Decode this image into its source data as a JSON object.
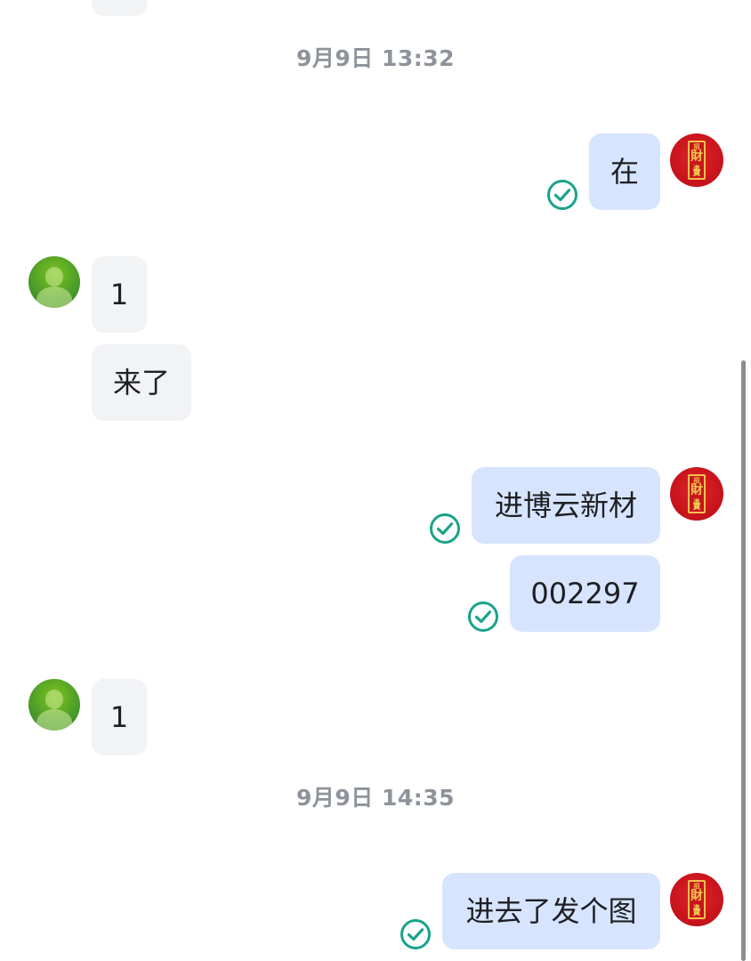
{
  "messages": [
    {
      "id": "top",
      "direction": "in",
      "text": ""
    },
    {
      "id": "ts1",
      "type": "timestamp",
      "text": "9月9日 13:32"
    },
    {
      "id": "m1",
      "direction": "out",
      "text": "在",
      "status": "read"
    },
    {
      "id": "m2",
      "direction": "in",
      "text": "1"
    },
    {
      "id": "m3",
      "direction": "in",
      "text": "来了"
    },
    {
      "id": "m4",
      "direction": "out",
      "text": "进博云新材",
      "status": "read"
    },
    {
      "id": "m5",
      "direction": "out",
      "text": "002297",
      "status": "read"
    },
    {
      "id": "m6",
      "direction": "in",
      "text": "1"
    },
    {
      "id": "ts2",
      "type": "timestamp",
      "text": "9月9日 14:35"
    },
    {
      "id": "m7",
      "direction": "out",
      "text": "进去了发个图",
      "status": "read"
    }
  ],
  "contact_avatar": {
    "icon": "person-placeholder-icon",
    "color": "#6ab320"
  },
  "self_avatar": {
    "icon": "zhao-cai-jin-bao-logo",
    "color": "#d0161e",
    "accent": "#f2c14e",
    "characters": [
      "招",
      "財",
      "進",
      "寶"
    ]
  },
  "colors": {
    "incoming_bubble": "#f2f3f5",
    "outgoing_bubble": "#d6e4fd",
    "check": "#1aa38a",
    "timestamp": "#8e939b"
  }
}
